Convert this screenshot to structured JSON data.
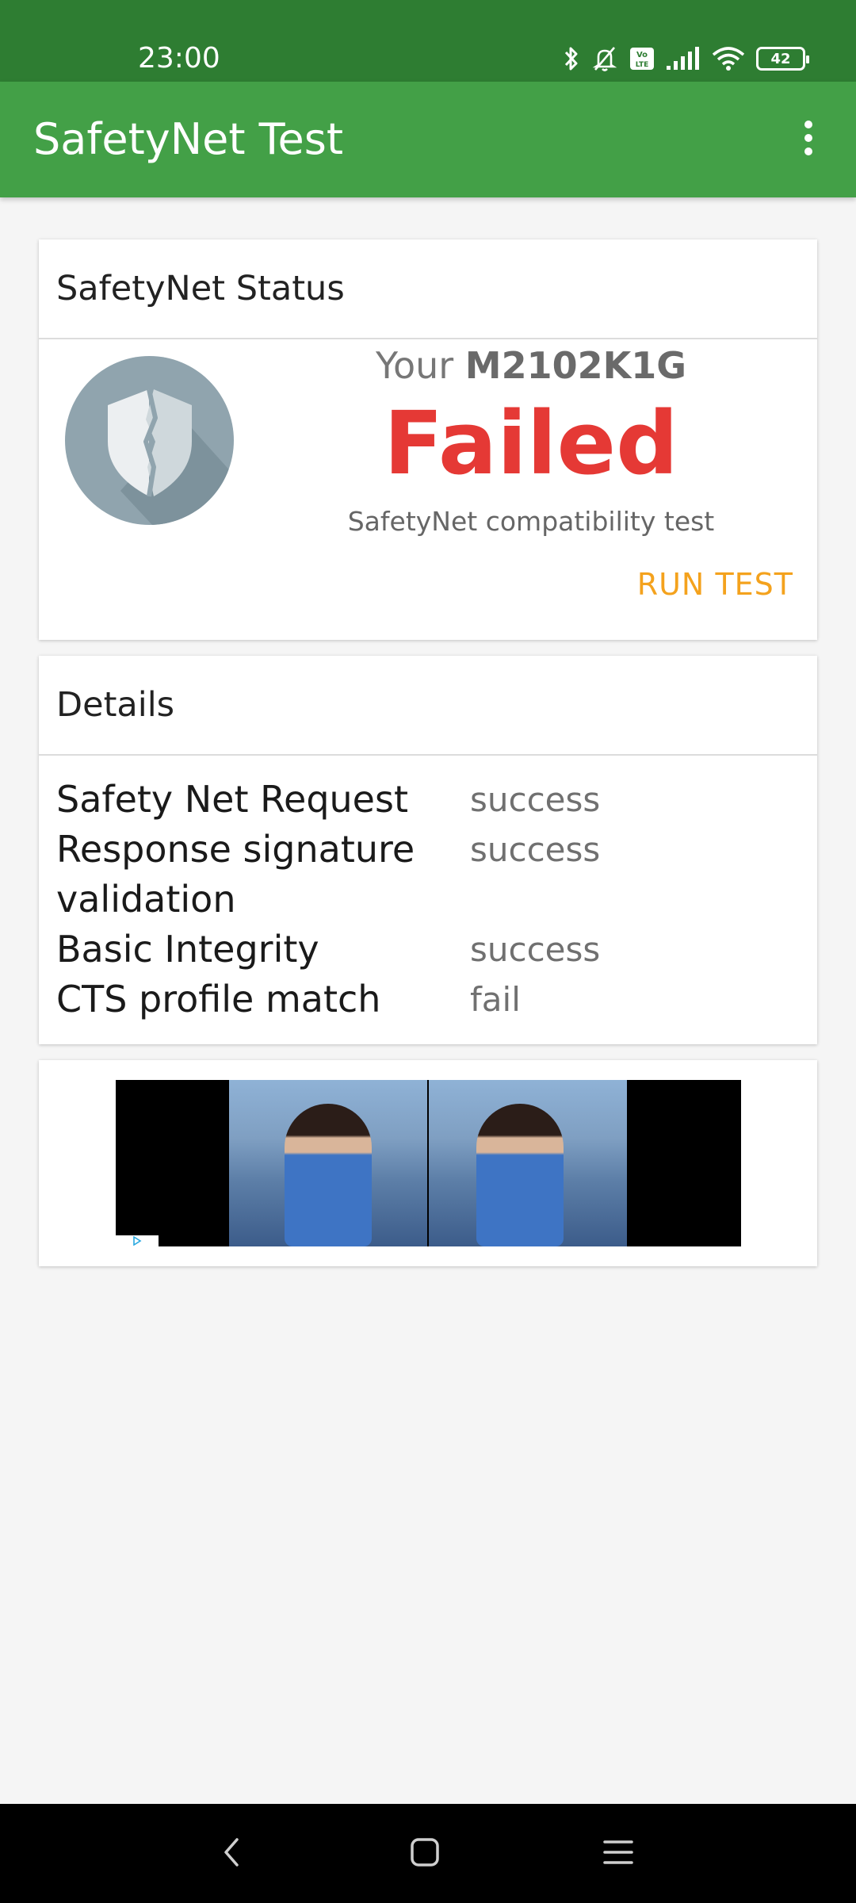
{
  "status_bar": {
    "time": "23:00",
    "battery": "42",
    "icons": [
      "bluetooth-icon",
      "notifications-muted-icon",
      "volte-icon",
      "signal-icon",
      "wifi-icon",
      "battery-icon"
    ]
  },
  "app_bar": {
    "title": "SafetyNet Test",
    "menu_icon": "more-vert-icon"
  },
  "status_card": {
    "header": "SafetyNet Status",
    "device_prefix": "Your",
    "device_model": "M2102K1G",
    "result": "Failed",
    "subtitle": "SafetyNet compatibility test",
    "run_button": "RUN TEST",
    "icon": "broken-shield-icon"
  },
  "details_card": {
    "header": "Details",
    "rows": [
      {
        "label": "Safety Net Request",
        "value": "success"
      },
      {
        "label": "Response signature validation",
        "value": "success"
      },
      {
        "label": "Basic Integrity",
        "value": "success"
      },
      {
        "label": "CTS profile match",
        "value": "fail"
      }
    ]
  },
  "colors": {
    "status_bar": "#2e7d32",
    "app_bar": "#43a047",
    "failed": "#e53935",
    "accent_button": "#f4a21d",
    "shield_circle": "#90a4ae"
  },
  "navigation": {
    "buttons": [
      "back-icon",
      "home-icon",
      "recents-icon"
    ]
  }
}
